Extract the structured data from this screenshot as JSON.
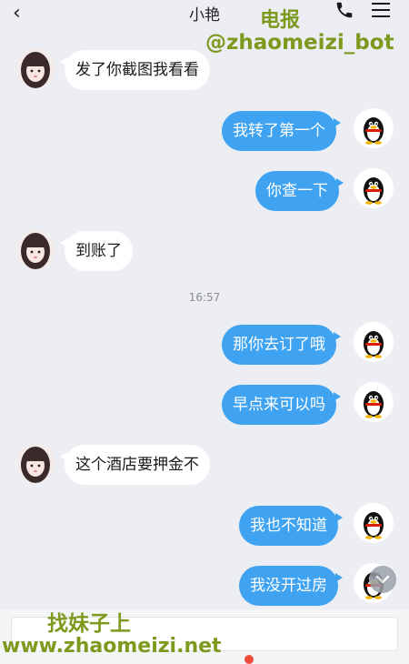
{
  "header": {
    "back_icon": "chevron-left-icon",
    "title": "小艳",
    "call_icon": "phone-icon",
    "menu_icon": "menu-icon"
  },
  "watermarks": {
    "tg": "电报",
    "bot": "@zhaomeizi_bot",
    "find": "找妹子上",
    "site": "www.zhaomeizi.net"
  },
  "messages": [
    {
      "side": "in",
      "text": "发了你截图我看看"
    },
    {
      "side": "out",
      "text": "我转了第一个"
    },
    {
      "side": "out",
      "text": "你查一下"
    },
    {
      "side": "in",
      "text": "到账了"
    },
    {
      "side": "out",
      "text": "那你去订了哦"
    },
    {
      "side": "out",
      "text": "早点来可以吗"
    },
    {
      "side": "in",
      "text": "这个酒店要押金不"
    },
    {
      "side": "out",
      "text": "我也不知道"
    },
    {
      "side": "out",
      "text": "我没开过房"
    }
  ],
  "timestamp": "16:57",
  "colors": {
    "background": "#eceef3",
    "outgoing_bubble": "#3fa3f2",
    "incoming_bubble": "#ffffff",
    "watermark": "#7c9a1e",
    "badge": "#f04b3c"
  },
  "icons": {
    "contact_avatar": "girl-avatar",
    "self_avatar": "qq-penguin-avatar",
    "scroll_down": "chevron-down-icon"
  }
}
